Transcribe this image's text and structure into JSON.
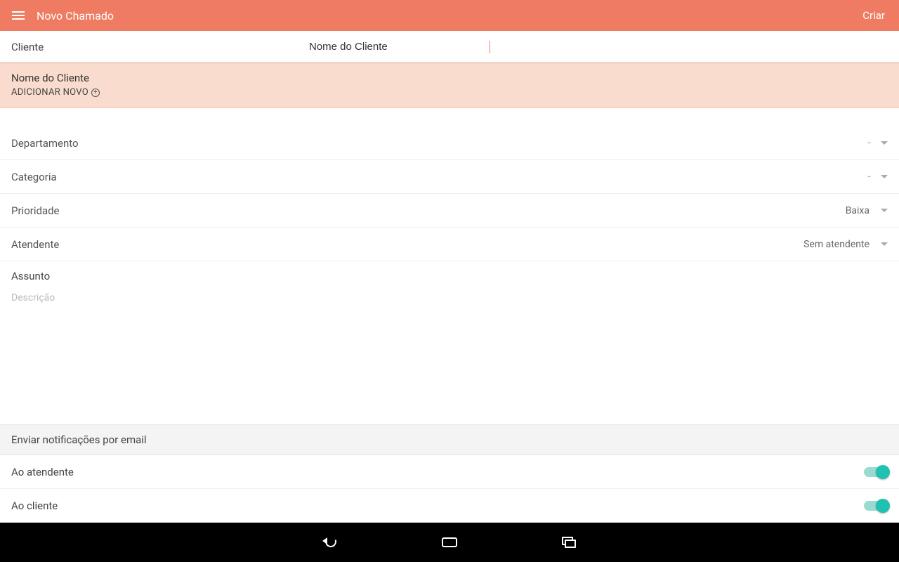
{
  "appbar": {
    "title": "Novo Chamado",
    "action": "Criar"
  },
  "client": {
    "label": "Cliente",
    "value": "Nome do Cliente"
  },
  "suggest": {
    "line1": "Nome do Cliente",
    "line2": "ADICIONAR NOVO"
  },
  "fields": {
    "department": {
      "label": "Departamento",
      "value": "-"
    },
    "category": {
      "label": "Categoria",
      "value": "-"
    },
    "priority": {
      "label": "Prioridade",
      "value": "Baixa"
    },
    "agent": {
      "label": "Atendente",
      "value": "Sem atendente"
    },
    "subject": {
      "label": "Assunto"
    },
    "description": {
      "placeholder": "Descrição"
    }
  },
  "notify": {
    "header": "Enviar notificações por email",
    "agent": {
      "label": "Ao atendente",
      "on": true
    },
    "client": {
      "label": "Ao cliente",
      "on": true
    }
  }
}
